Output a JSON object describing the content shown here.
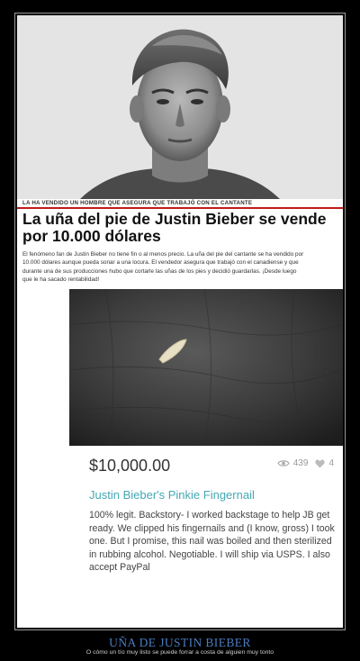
{
  "article": {
    "kicker": "LA HA VENDIDO UN HOMBRE QUE ASEGURA QUE TRABAJÓ CON EL CANTANTE",
    "headline": "La uña del pie de Justin Bieber se vende por 10.000 dólares",
    "lede_line1": "El fenómeno fan de Justin Bieber no tiene fin o al menos precio. La uña del pie del cantante se ha vendido por",
    "lede_line2": "10.000 dólares aunque pueda sonar a una locura. El vendedor asegura que trabajó con el canadiense y que",
    "lede_line3": "durante una de sus producciones hubo que cortarle las uñas de los pies y decidió guardarlas. ¡Desde luego",
    "lede_line4": "que le ha sacado rentabilidad!",
    "accent_color": "#c21b1b"
  },
  "listing": {
    "price": "$10,000.00",
    "views": "439",
    "likes": "4",
    "title": "Justin Bieber's Pinkie Fingernail",
    "description": "100% legit. Backstory- I worked backstage to help JB get ready. We clipped his fingernails and (I know, gross) I took one. But I promise, this nail was boiled and then sterilized in rubbing alcohol. Negotiable. I will ship via USPS. I also accept PayPal",
    "title_color": "#44a8b3"
  },
  "caption": {
    "title": "UÑA DE JUSTIN BIEBER",
    "subtitle": "O cómo un tío muy listo se puede forrar a costa de alguien muy tonto",
    "title_color": "#4a7cc0"
  },
  "icons": {
    "views": "eye-icon",
    "likes": "heart-icon"
  }
}
